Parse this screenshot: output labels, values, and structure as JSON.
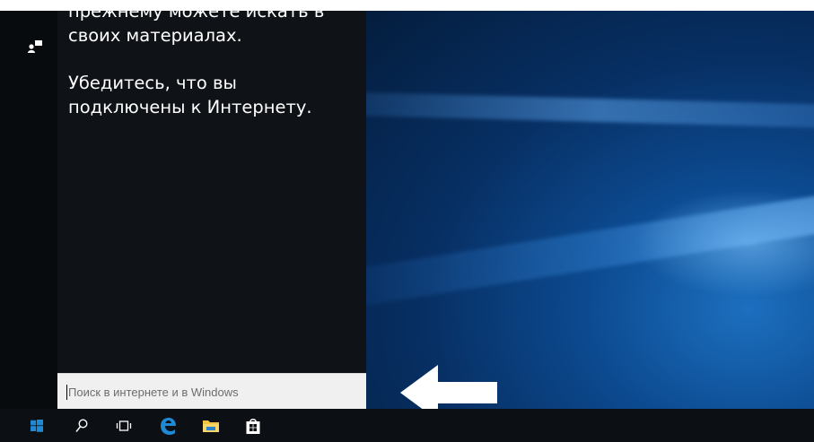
{
  "cortana": {
    "line1": "прежнему можете искать в",
    "line2": "своих материалах.",
    "line3": "Убедитесь, что вы",
    "line4": "подключены к Интернету."
  },
  "search": {
    "placeholder": "Поиск в интернете и в Windows"
  },
  "taskbar": {
    "items": [
      {
        "icon": "windows-start-icon"
      },
      {
        "icon": "search-icon"
      },
      {
        "icon": "task-view-icon"
      },
      {
        "icon": "edge-icon"
      },
      {
        "icon": "file-explorer-icon"
      },
      {
        "icon": "store-icon"
      }
    ]
  },
  "colors": {
    "panel_bg": "#0f1216",
    "taskbar_bg": "#0c0f13",
    "accent_blue": "#1e8ad6",
    "folder_yellow": "#f5c342",
    "desktop_blue": "#0c4a90"
  }
}
